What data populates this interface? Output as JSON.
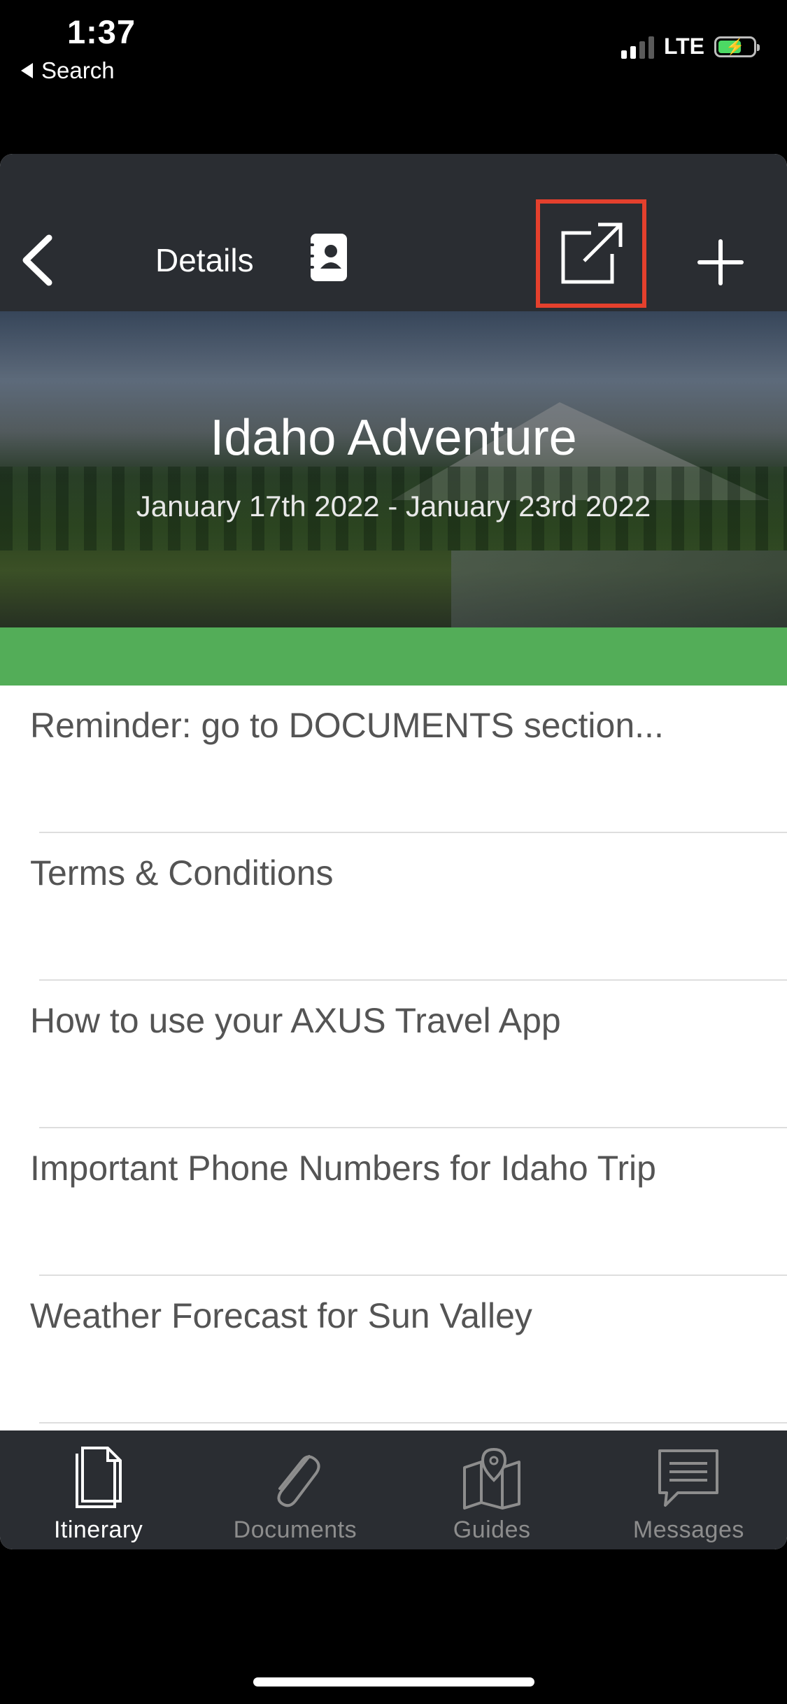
{
  "status_bar": {
    "time": "1:37",
    "back_label": "Search",
    "network": "LTE"
  },
  "navbar": {
    "title": "Details",
    "icons": [
      "chevron-left-icon",
      "contacts-book-icon",
      "share-external-icon",
      "plus-icon"
    ],
    "highlight_color": "#e4402d"
  },
  "hero": {
    "title": "Idaho Adventure",
    "dates": "January 17th 2022 - January 23rd 2022"
  },
  "accent_color": "#53ad58",
  "items": [
    {
      "label": "Reminder: go to DOCUMENTS section..."
    },
    {
      "label": "Terms & Conditions"
    },
    {
      "label": "How to use your AXUS Travel App"
    },
    {
      "label": "Important Phone Numbers for Idaho Trip"
    },
    {
      "label": "Weather Forecast for Sun Valley"
    }
  ],
  "tabs": [
    {
      "label": "Itinerary",
      "icon": "document-icon",
      "active": true
    },
    {
      "label": "Documents",
      "icon": "paperclip-icon",
      "active": false
    },
    {
      "label": "Guides",
      "icon": "map-pin-icon",
      "active": false
    },
    {
      "label": "Messages",
      "icon": "message-icon",
      "active": false
    }
  ]
}
